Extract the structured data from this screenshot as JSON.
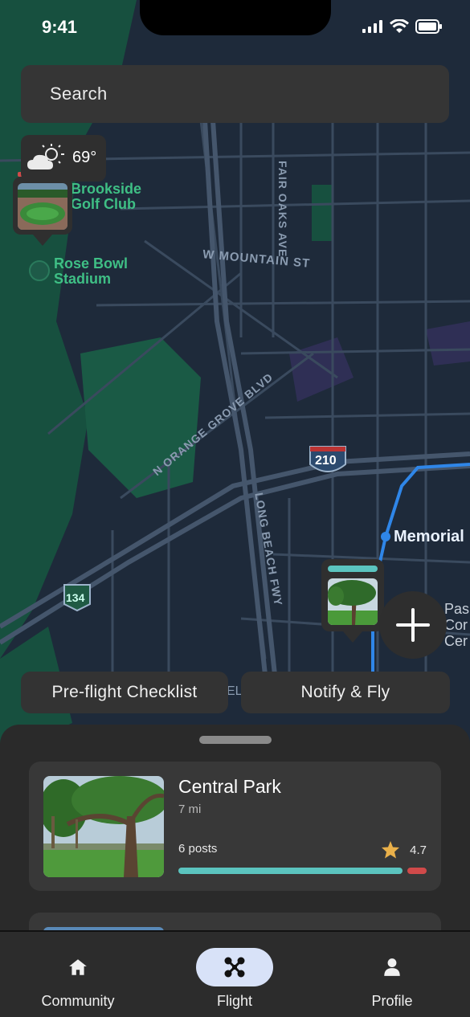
{
  "status_bar": {
    "time": "9:41"
  },
  "search": {
    "placeholder": "Search"
  },
  "weather": {
    "temperature": "69°",
    "icon": "partly-cloudy-icon"
  },
  "map": {
    "labels": {
      "golf_club_line1": "Brookside",
      "golf_club_line2": "Golf Club",
      "stadium_line1": "Rose Bowl",
      "stadium_line2": "Stadium",
      "street_mountain": "W MOUNTAIN ST",
      "street_fair_oaks": "FAIR OAKS AVE",
      "street_orange_grove": "N ORANGE GROVE BLVD",
      "street_long_beach": "LONG BEACH FWY",
      "hwy_210": "210",
      "hwy_134": "134",
      "station": "Memorial",
      "partial_place_1": "Pas",
      "partial_place_2": "Cor",
      "partial_place_3": "Cer",
      "partial_place_4": "EL"
    },
    "colors": {
      "background": "#1e2a3a",
      "park": "#17503f",
      "transit": "#2f86e8"
    }
  },
  "actions": {
    "preflight_label": "Pre-flight Checklist",
    "notify_label": "Notify & Fly"
  },
  "sheet": {
    "cards": [
      {
        "title": "Central Park",
        "distance": "7 mi",
        "posts": "6 posts",
        "rating": "4.7",
        "positive_fraction": 0.92
      }
    ]
  },
  "tabs": [
    {
      "label": "Community",
      "icon": "home-icon"
    },
    {
      "label": "Flight",
      "icon": "drone-icon",
      "active": true
    },
    {
      "label": "Profile",
      "icon": "person-icon"
    }
  ],
  "accent_colors": {
    "teal": "#5bc4bf",
    "red": "#d04a4a",
    "star": "#e9b04a",
    "active_tab": "#d8e2f8"
  }
}
